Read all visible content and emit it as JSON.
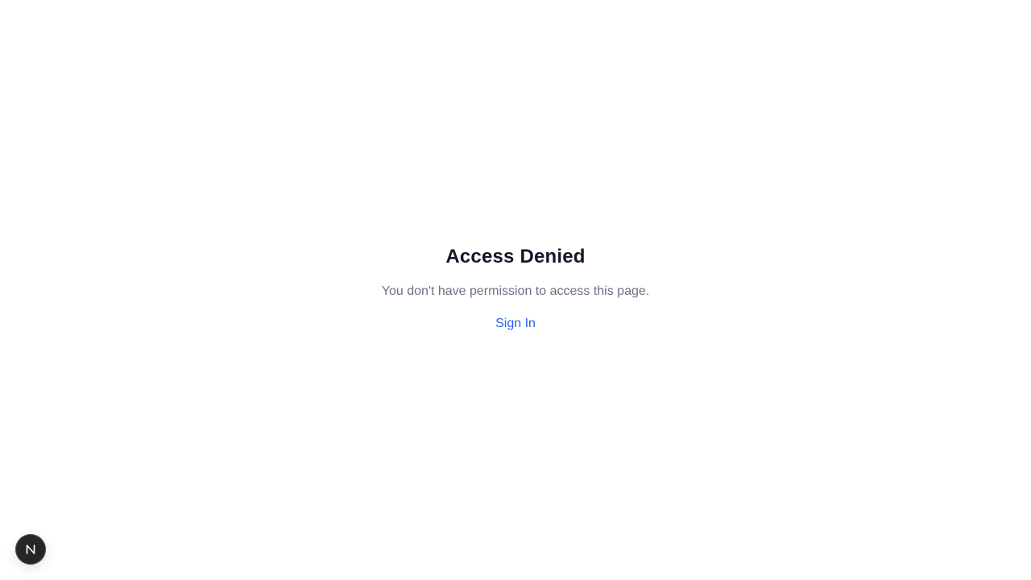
{
  "main": {
    "title": "Access Denied",
    "message": "You don't have permission to access this page.",
    "sign_in_label": "Sign In"
  },
  "dev_badge": {
    "icon": "nextjs-logo-icon",
    "letter": "N"
  },
  "colors": {
    "title": "#111827",
    "message": "#6b7280",
    "link": "#2563eb",
    "badge_bg": "#262626"
  }
}
